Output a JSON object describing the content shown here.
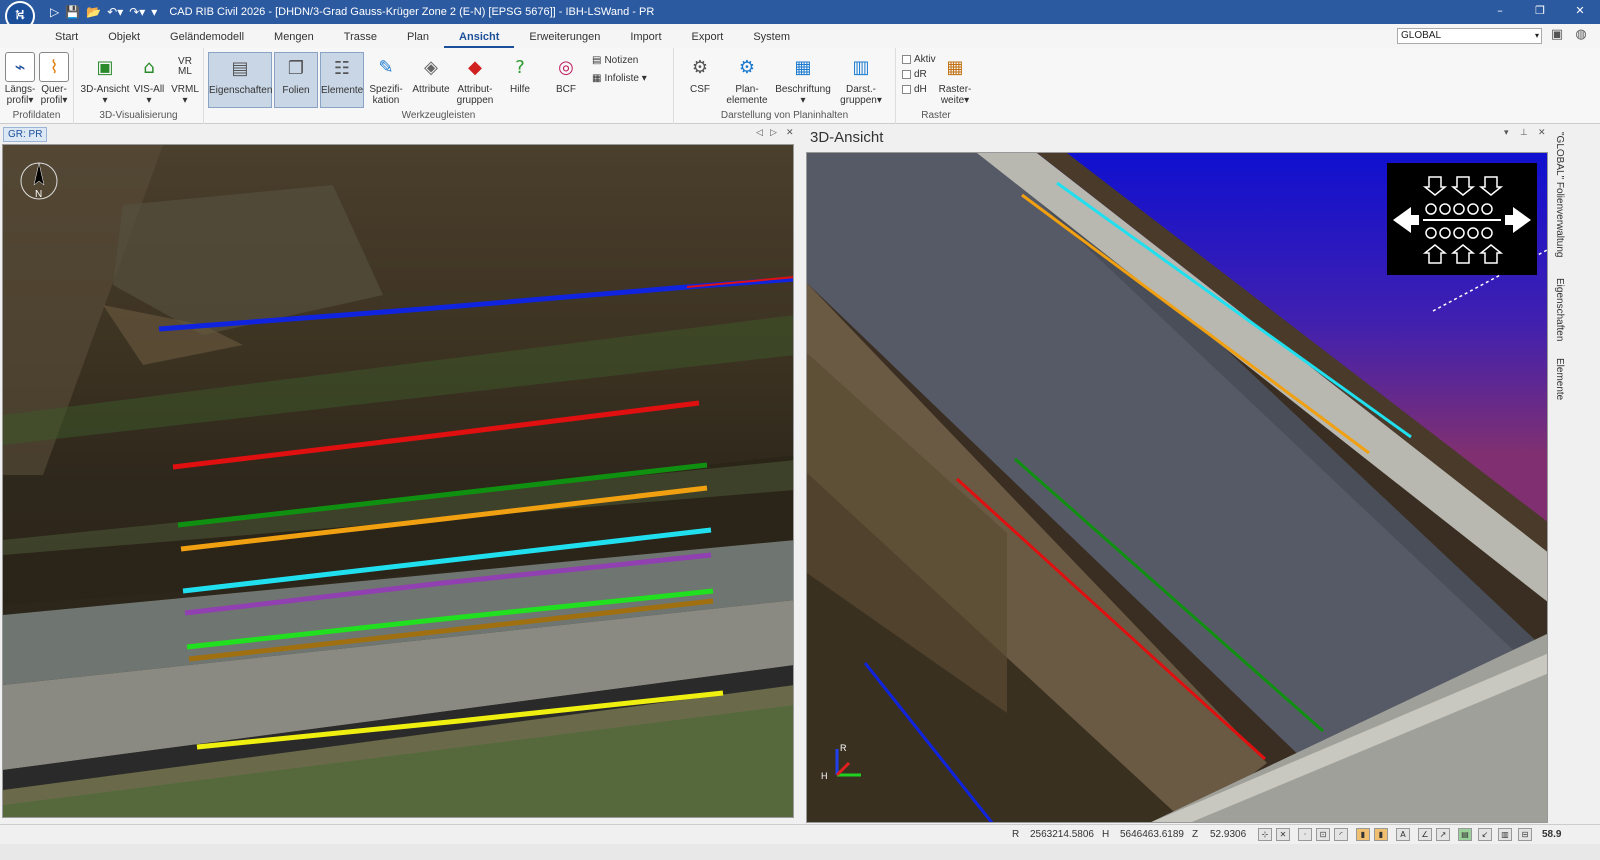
{
  "window": {
    "title": "CAD RIB Civil 2026 - [DHDN/3-Grad Gauss-Krüger Zone 2 (E-N) [EPSG 5676]] - IBH-LSWand - PR",
    "controls": [
      "–",
      "❐",
      "✕"
    ]
  },
  "quick_access": [
    "▷",
    "💾",
    "📂",
    "↶▾",
    "↷▾",
    "▾"
  ],
  "ribbon_tabs": [
    "Start",
    "Objekt",
    "Geländemodell",
    "Mengen",
    "Trasse",
    "Plan",
    "Ansicht",
    "Erweiterungen",
    "Import",
    "Export",
    "System"
  ],
  "active_tab": "Ansicht",
  "layer_selector": {
    "value": "GLOBAL"
  },
  "groups": {
    "profildaten": {
      "label": "Profildaten",
      "buttons": [
        {
          "label": "Längs-\nprofil▾",
          "icon": "longitudinal-profile-icon"
        },
        {
          "label": "Quer-\nprofil▾",
          "icon": "cross-profile-icon"
        }
      ]
    },
    "visualisierung": {
      "label": "3D-Visualisierung",
      "buttons": [
        {
          "label": "3D-Ansicht\n▾",
          "icon": "3d-view-icon"
        },
        {
          "label": "VIS-All\n▾",
          "icon": "vis-all-icon"
        },
        {
          "label": "VRML\n▾",
          "icon": "vrml-icon"
        }
      ],
      "vrml_icon_text": "VR\nML"
    },
    "werkzeugleisten": {
      "label": "Werkzeugleisten",
      "buttons": [
        {
          "label": "Eigenschaften",
          "icon": "properties-icon"
        },
        {
          "label": "Folien",
          "icon": "layers-icon"
        },
        {
          "label": "Elemente",
          "icon": "elements-icon"
        },
        {
          "label": "Spezifi-\nkation",
          "icon": "specification-icon"
        },
        {
          "label": "Attribute",
          "icon": "attribute-icon"
        },
        {
          "label": "Attribut-\ngruppen",
          "icon": "attribute-groups-icon"
        },
        {
          "label": "Hilfe",
          "icon": "help-icon"
        },
        {
          "label": "BCF",
          "icon": "bcf-icon"
        }
      ],
      "small": [
        "Notizen",
        "Infoliste ▾"
      ]
    },
    "darstellung": {
      "label": "Darstellung von Planinhalten",
      "buttons": [
        {
          "label": "CSF",
          "icon": "csf-icon"
        },
        {
          "label": "Plan-\nelemente",
          "icon": "plan-elements-icon"
        },
        {
          "label": "Beschriftung\n▾",
          "icon": "labeling-icon"
        },
        {
          "label": "Darst.-\ngruppen▾",
          "icon": "display-groups-icon"
        }
      ]
    },
    "raster": {
      "label": "Raster",
      "checks": [
        "Aktiv",
        "dR",
        "dH"
      ],
      "button": {
        "label": "Raster-\nweite▾",
        "icon": "raster-width-icon"
      }
    }
  },
  "panes": {
    "left_tab": "GR: PR",
    "right_title": "3D-Ansicht",
    "compass_letter": "N",
    "axis_labels": {
      "x": "H",
      "y": "R"
    }
  },
  "sidebar": {
    "items": [
      "\"GLOBAL\" Folienverwaltung",
      "Eigenschaften",
      "Elemente"
    ]
  },
  "status": {
    "r_label": "R",
    "r_value": "2563214.5806",
    "h_label": "H",
    "h_value": "5646463.6189",
    "z_label": "Z",
    "z_value": "52.9306",
    "zoom": "58.9"
  },
  "polylines_colors": {
    "blue": "#1024e0",
    "red": "#e01010",
    "green": "#109010",
    "orange": "#f0a010",
    "cyan": "#20e0f0",
    "purple": "#9040b0",
    "lime": "#20e020",
    "brown": "#a07010",
    "yellow": "#f0f010"
  }
}
